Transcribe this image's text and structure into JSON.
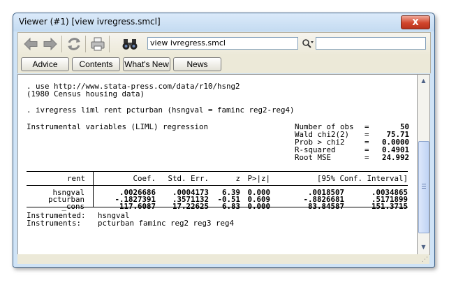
{
  "window": {
    "title": "Viewer (#1) [view ivregress.smcl]",
    "close_label": "X"
  },
  "toolbar": {
    "address": "view ivregress.smcl",
    "find_value": "",
    "icons": [
      "back-arrow-icon",
      "forward-arrow-icon",
      "refresh-icon",
      "print-icon",
      "binoculars-icon",
      "find-icon"
    ]
  },
  "buttons": {
    "advice": "Advice",
    "contents": "Contents",
    "whats_new": "What's New",
    "news": "News"
  },
  "output": {
    "line1": ". use http://www.stata-press.com/data/r10/hsng2",
    "line2": "(1980 Census housing data)",
    "line3": ". ivregress liml rent pcturban (hsngval = faminc reg2-reg4)",
    "line4": "Instrumental variables (LIML) regression",
    "stats": [
      {
        "label": "Number of obs",
        "eq": "=",
        "value": "50"
      },
      {
        "label": "Wald chi2(2)",
        "eq": "=",
        "value": "75.71"
      },
      {
        "label": "Prob > chi2",
        "eq": "=",
        "value": "0.0000"
      },
      {
        "label": "R-squared",
        "eq": "=",
        "value": "0.4901"
      },
      {
        "label": "Root MSE",
        "eq": "=",
        "value": "24.992"
      }
    ],
    "table": {
      "depvar": "rent",
      "headers": [
        "Coef.",
        "Std. Err.",
        "z",
        "P>|z|",
        "[95% Conf. Interval]"
      ],
      "rows": [
        {
          "name": "hsngval",
          "coef": ".0026686",
          "se": ".0004173",
          "z": "6.39",
          "p": "0.000",
          "lo": ".0018507",
          "hi": ".0034865"
        },
        {
          "name": "pcturban",
          "coef": "-.1827391",
          "se": ".3571132",
          "z": "-0.51",
          "p": "0.609",
          "lo": "-.8826681",
          "hi": ".5171899"
        },
        {
          "name": "_cons",
          "coef": "117.6087",
          "se": "17.22625",
          "z": "6.83",
          "p": "0.000",
          "lo": "83.84587",
          "hi": "151.3715"
        }
      ]
    },
    "instrumented_label": "Instrumented:",
    "instrumented_value": "hsngval",
    "instruments_label": "Instruments:",
    "instruments_value": "pcturban faminc reg2 reg3 reg4"
  }
}
